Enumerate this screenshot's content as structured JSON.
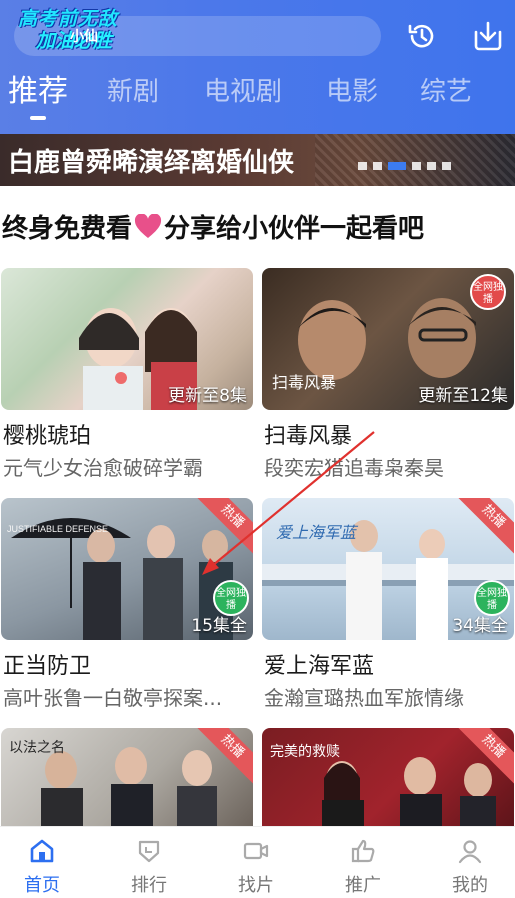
{
  "header": {
    "logo_line1": "高考前无敌",
    "logo_line2": "加油必胜",
    "logo_mid": "小仙",
    "history_icon": "history-icon",
    "download_icon": "download-icon",
    "accent": "#4c78ea"
  },
  "tabs": [
    {
      "label": "推荐",
      "active": true
    },
    {
      "label": "新剧"
    },
    {
      "label": "电视剧"
    },
    {
      "label": "电影"
    },
    {
      "label": "综艺"
    }
  ],
  "banner": {
    "title": "白鹿曾舜晞演绎离婚仙侠",
    "dot_count": 6,
    "active_dot": 2
  },
  "promo": {
    "text_before": "终身免费看",
    "text_after": "分享给小伙伴一起看吧",
    "heart_color": "#e8508a"
  },
  "cards": [
    {
      "title": "樱桃琥珀",
      "subtitle": "元气少女治愈破碎学霸",
      "badge": "更新至8集",
      "corner": ""
    },
    {
      "title": "扫毒风暴",
      "subtitle": "段奕宏猎追毒枭秦昊",
      "badge": "更新至12集",
      "corner": "全网独播"
    },
    {
      "title": "正当防卫",
      "subtitle": "高叶张鲁一白敬亭探案...",
      "badge": "15集全",
      "hot": "热播",
      "corner": "全网独播"
    },
    {
      "title": "爱上海军蓝",
      "subtitle": "金瀚宣璐热血军旅情缘",
      "badge": "34集全",
      "hot": "热播",
      "corner": "全网独播"
    },
    {
      "title": "",
      "subtitle": "",
      "badge": "",
      "hot": "热播"
    },
    {
      "title": "",
      "subtitle": "",
      "badge": "",
      "hot": "热播"
    }
  ],
  "bottom_nav": [
    {
      "label": "首页",
      "icon": "home-icon",
      "active": true
    },
    {
      "label": "排行",
      "icon": "ranking-icon"
    },
    {
      "label": "找片",
      "icon": "video-search-icon"
    },
    {
      "label": "推广",
      "icon": "thumbs-up-icon"
    },
    {
      "label": "我的",
      "icon": "profile-icon"
    }
  ]
}
